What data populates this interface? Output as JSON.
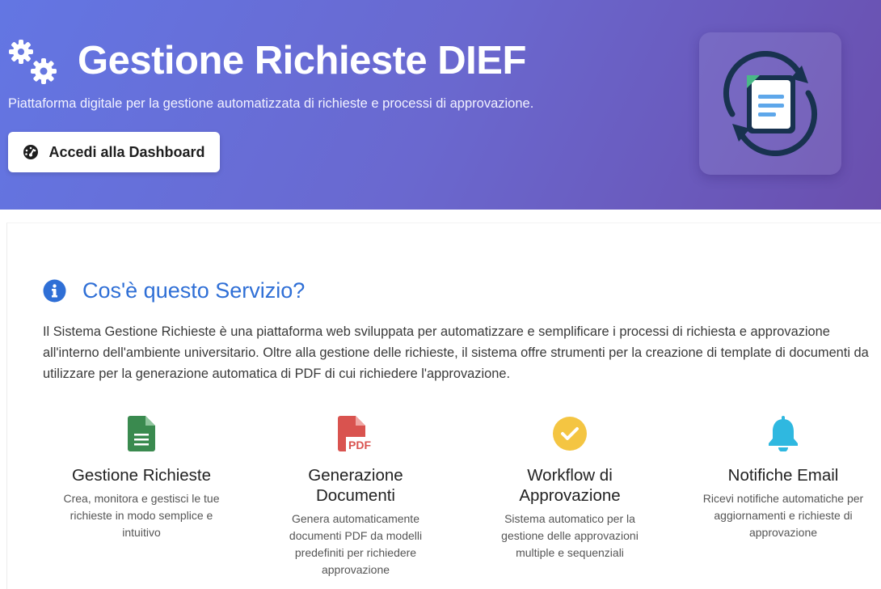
{
  "hero": {
    "title": "Gestione Richieste DIEF",
    "subtitle": "Piattaforma digitale per la gestione automatizzata di richieste e processi di approvazione.",
    "dashboard_button": "Accedi alla Dashboard"
  },
  "about": {
    "title": "Cos'è questo Servizio?",
    "description": "Il Sistema Gestione Richieste è una piattaforma web sviluppata per automatizzare e semplificare i processi di richiesta e approvazione all'interno dell'ambiente universitario. Oltre alla gestione delle richieste, il sistema offre strumenti per la creazione di template di documenti da utilizzare per la generazione automatica di PDF di cui richiedere l'approvazione."
  },
  "features": [
    {
      "icon": "file-text-icon",
      "title": "Gestione Richieste",
      "desc": "Crea, monitora e gestisci le tue richieste in modo semplice e intuitivo"
    },
    {
      "icon": "file-pdf-icon",
      "title": "Generazione Documenti",
      "desc": "Genera automaticamente documenti PDF da modelli predefiniti per richiedere approvazione"
    },
    {
      "icon": "check-circle-icon",
      "title": "Workflow di Approvazione",
      "desc": "Sistema automatico per la gestione delle approvazioni multiple e sequenziali"
    },
    {
      "icon": "bell-icon",
      "title": "Notifiche Email",
      "desc": "Ricevi notifiche automatiche per aggiornamenti e richieste di approvazione"
    }
  ],
  "colors": {
    "accent": "#2f6fd6",
    "gradient_start": "#6376e3",
    "gradient_end": "#6a4fae",
    "green": "#3a8a4f",
    "red": "#d9534f",
    "yellow": "#f4c542",
    "cyan": "#2fb8e0"
  }
}
